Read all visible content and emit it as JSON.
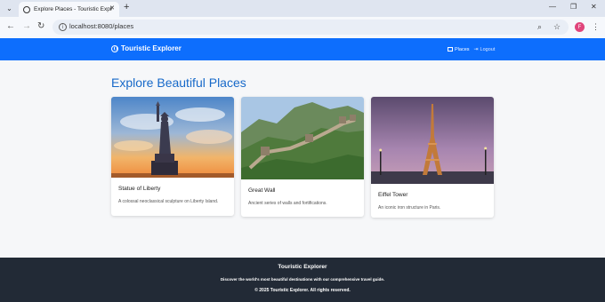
{
  "browser": {
    "tab_title": "Explore Places - Touristic Explorer",
    "url": "localhost:8080/places",
    "profile_initial": "F"
  },
  "navbar": {
    "brand": "Touristic Explorer",
    "links": [
      {
        "label": "Places",
        "icon": "places-icon"
      },
      {
        "label": "Logout",
        "icon": "logout-icon"
      }
    ]
  },
  "main": {
    "heading": "Explore Beautiful Places",
    "places": [
      {
        "name": "Statue of Liberty",
        "description": "A colossal neoclassical sculpture on Liberty Island."
      },
      {
        "name": "Great Wall",
        "description": "Ancient series of walls and fortifications."
      },
      {
        "name": "Eiffel Tower",
        "description": "An iconic iron structure in Paris."
      }
    ]
  },
  "footer": {
    "title": "Touristic Explorer",
    "tagline": "Discover the world's most beautiful destinations with our comprehensive travel guide.",
    "copyright": "© 2025 Touristic Explorer. All rights reserved."
  },
  "colors": {
    "navbar": "#0d6efd",
    "heading": "#1769c9",
    "footer": "#222a36"
  }
}
